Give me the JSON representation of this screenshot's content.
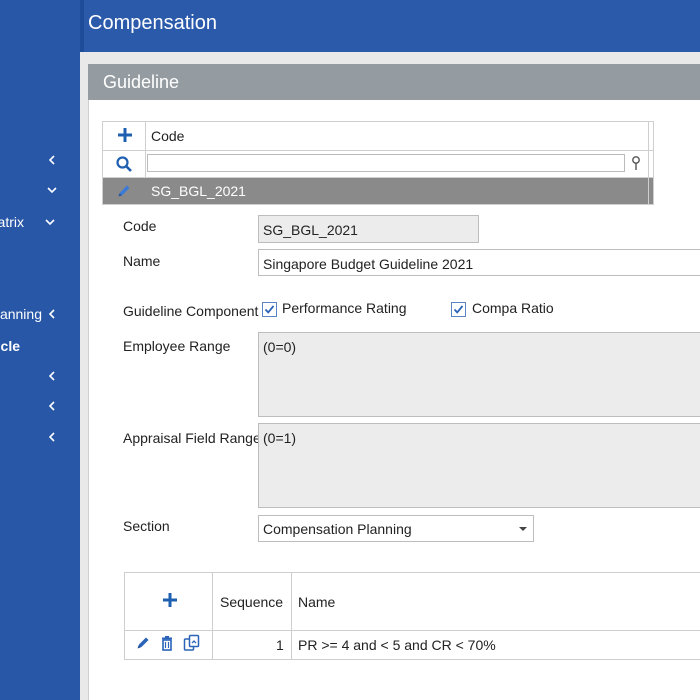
{
  "header": {
    "title": "Compensation"
  },
  "sidebar": {
    "items": [
      {
        "label": "",
        "chevron": "chevron-left-icon"
      },
      {
        "label": "",
        "chevron": "chevron-down-icon"
      },
      {
        "label": "atrix",
        "chevron": "chevron-down-icon"
      },
      {
        "label": "anning",
        "chevron": "chevron-left-icon"
      },
      {
        "label": "cle",
        "chevron": ""
      },
      {
        "label": "",
        "chevron": "chevron-left-icon"
      },
      {
        "label": "",
        "chevron": "chevron-left-icon"
      },
      {
        "label": "",
        "chevron": "chevron-left-icon"
      }
    ]
  },
  "panel": {
    "title": "Guideline"
  },
  "grid": {
    "column_header": "Code",
    "filter_value": "",
    "selected_row": "SG_BGL_2021"
  },
  "form": {
    "code_label": "Code",
    "code_value": "SG_BGL_2021",
    "name_label": "Name",
    "name_value": "Singapore Budget Guideline 2021",
    "component_label": "Guideline Component",
    "components": [
      {
        "label": "Performance Rating",
        "checked": true
      },
      {
        "label": "Compa Ratio",
        "checked": true
      }
    ],
    "employee_range_label": "Employee Range",
    "employee_range_value": "(0=0)",
    "appraisal_range_label": "Appraisal Field Range",
    "appraisal_range_value": "(0=1)",
    "section_label": "Section",
    "section_value": "Compensation Planning"
  },
  "table": {
    "headers": {
      "sequence": "Sequence",
      "name": "Name"
    },
    "rows": [
      {
        "sequence": "1",
        "name": "PR >= 4 and < 5 and CR < 70%"
      }
    ]
  },
  "colors": {
    "sidebar": "#2857a8",
    "header": "#2b5aab",
    "panel_header": "#959ca1",
    "accent": "#1f5fb0",
    "selected_row": "#8a8a8a"
  }
}
